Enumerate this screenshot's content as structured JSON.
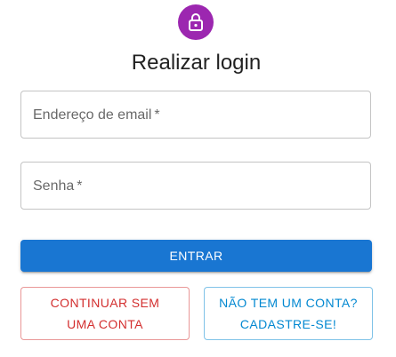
{
  "colors": {
    "avatar_bg": "#9c27b0",
    "primary": "#1976d2",
    "error": "#d32f2f",
    "info": "#0288d1"
  },
  "header": {
    "icon": "lock-icon",
    "title": "Realizar login"
  },
  "form": {
    "email": {
      "label": "Endereço de email",
      "required_mark": "*",
      "value": ""
    },
    "password": {
      "label": "Senha",
      "required_mark": "*",
      "value": ""
    },
    "submit_label": "ENTRAR"
  },
  "actions": {
    "guest_line1": "CONTINUAR SEM",
    "guest_line2": "UMA CONTA",
    "signup_line1": "NÃO TEM UM CONTA?",
    "signup_line2": "CADASTRE-SE!"
  }
}
